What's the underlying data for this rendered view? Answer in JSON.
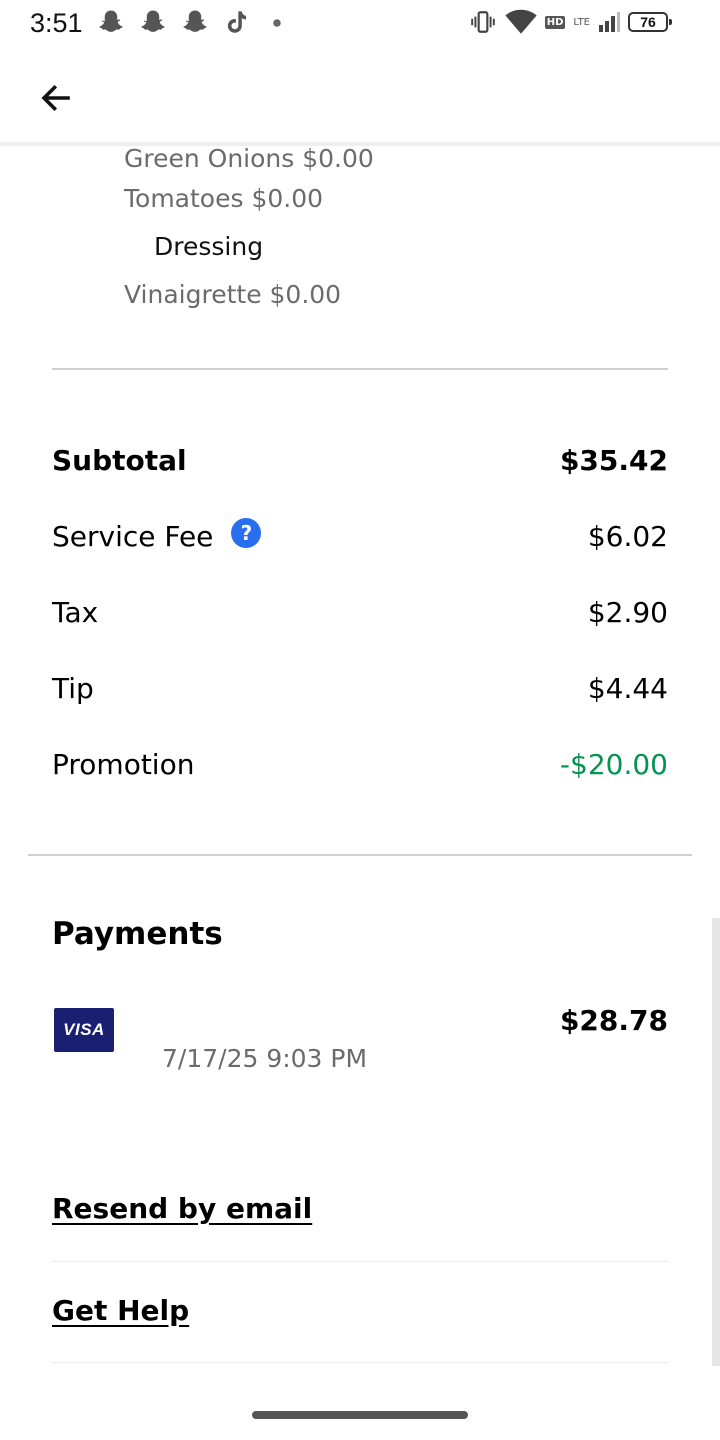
{
  "status_bar": {
    "time": "3:51",
    "notification_icons": [
      "snapchat-icon",
      "snapchat-icon",
      "snapchat-icon",
      "tiktok-icon",
      "dot-icon"
    ],
    "hd_label": "HD",
    "network_label": "LTE",
    "battery_level": "76"
  },
  "header": {
    "back_icon": "arrow-left-icon"
  },
  "item_modifiers": {
    "green_onions": "Green Onions $0.00",
    "tomatoes": "Tomatoes $0.00",
    "dressing_group": "Dressing",
    "vinaigrette": "Vinaigrette $0.00"
  },
  "summary": {
    "subtotal_label": "Subtotal",
    "subtotal_value": "$35.42",
    "service_fee_label": "Service Fee",
    "service_fee_value": "$6.02",
    "tax_label": "Tax",
    "tax_value": "$2.90",
    "tip_label": "Tip",
    "tip_value": "$4.44",
    "promotion_label": "Promotion",
    "promotion_value": "-$20.00"
  },
  "payments": {
    "title": "Payments",
    "card_brand": "VISA",
    "amount": "$28.78",
    "date": "7/17/25 9:03 PM"
  },
  "links": {
    "resend": "Resend by email",
    "help": "Get Help"
  },
  "colors": {
    "promo_green": "#05944f",
    "help_blue": "#276ef1",
    "visa_navy": "#1a1f71"
  }
}
